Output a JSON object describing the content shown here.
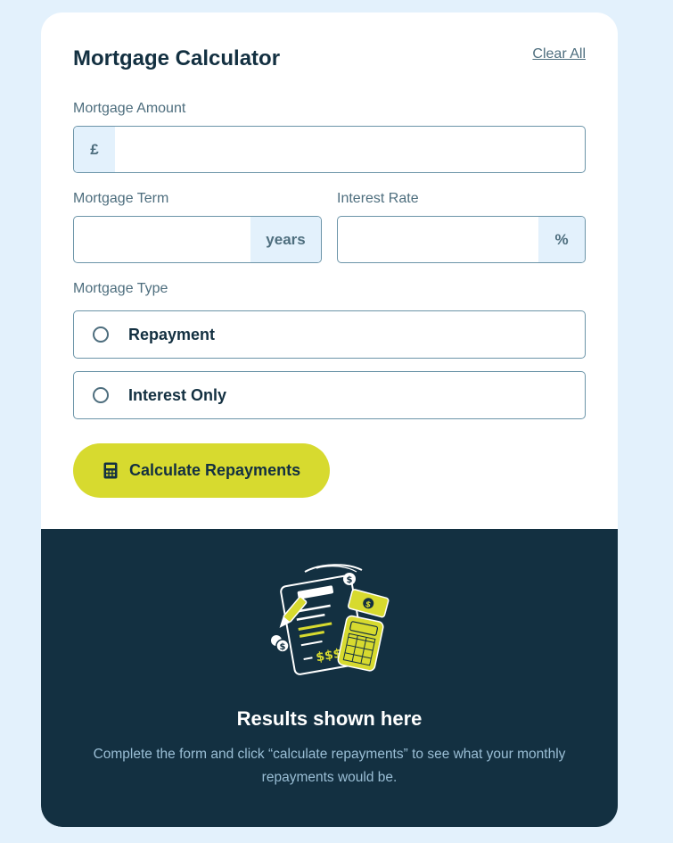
{
  "header": {
    "title": "Mortgage Calculator",
    "clear_label": "Clear All"
  },
  "amount": {
    "label": "Mortgage Amount",
    "prefix": "£",
    "value": ""
  },
  "term": {
    "label": "Mortgage Term",
    "suffix": "years",
    "value": ""
  },
  "rate": {
    "label": "Interest Rate",
    "suffix": "%",
    "value": ""
  },
  "type": {
    "label": "Mortgage Type",
    "options": [
      {
        "label": "Repayment",
        "selected": false
      },
      {
        "label": "Interest Only",
        "selected": false
      }
    ]
  },
  "calculate": {
    "label": "Calculate Repayments",
    "icon": "calculator-icon"
  },
  "results": {
    "title": "Results shown here",
    "description": "Complete the form and click “calculate repayments” to see what your monthly repayments would be.",
    "illustration": "empty-results-illustration"
  },
  "colors": {
    "page_bg": "#e3f1fc",
    "card_bg": "#ffffff",
    "dark": "#133041",
    "accent": "#d7da2f",
    "muted": "#4e6e7e",
    "border": "#6b94a8",
    "addon_bg": "#e3f1fc"
  }
}
